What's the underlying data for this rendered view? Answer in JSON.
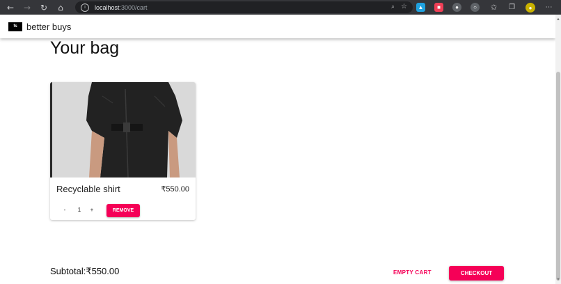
{
  "browser": {
    "url_host": "localhost",
    "url_path": ":3000/cart",
    "icons": [
      "back-icon",
      "forward-icon",
      "reload-icon",
      "home-icon",
      "info-icon",
      "zoom-icon",
      "favorite-icon"
    ]
  },
  "header": {
    "logo_text": "fs",
    "brand": "better buys"
  },
  "page": {
    "title": "Your bag"
  },
  "cart": {
    "items": [
      {
        "name": "Recyclable shirt",
        "price": "₹550.00",
        "quantity": "1",
        "decrement_label": "-",
        "increment_label": "+",
        "remove_label": "REMOVE"
      }
    ]
  },
  "summary": {
    "subtotal": "Subtotal:₹550.00",
    "empty_label": "EMPTY CART",
    "checkout_label": "CHECKOUT"
  },
  "colors": {
    "accent": "#f50057",
    "chrome": "#35363a"
  }
}
